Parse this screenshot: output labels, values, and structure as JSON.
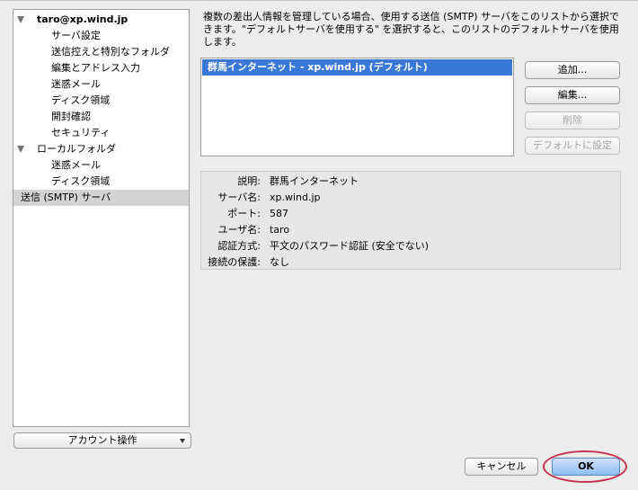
{
  "tree": {
    "account": "taro@xp.wind.jp",
    "account_children": [
      "サーバ設定",
      "送信控えと特別なフォルダ",
      "編集とアドレス入力",
      "迷惑メール",
      "ディスク領域",
      "開封確認",
      "セキュリティ"
    ],
    "local": "ローカルフォルダ",
    "local_children": [
      "迷惑メール",
      "ディスク領域"
    ],
    "smtp": "送信 (SMTP) サーバ"
  },
  "account_actions_label": "アカウント操作",
  "description": "複数の差出人情報を管理している場合、使用する送信 (SMTP) サーバをこのリストから選択できます。\"デフォルトサーバを使用する\" を選択すると、このリストのデフォルトサーバを使用します。",
  "servers": [
    "群馬インターネット - xp.wind.jp (デフォルト)"
  ],
  "buttons": {
    "add": "追加...",
    "edit": "編集...",
    "delete": "削除",
    "set_default": "デフォルトに設定",
    "cancel": "キャンセル",
    "ok": "OK"
  },
  "details": {
    "description_label": "説明:",
    "description_value": "群馬インターネット",
    "server_label": "サーバ名:",
    "server_value": "xp.wind.jp",
    "port_label": "ポート:",
    "port_value": "587",
    "user_label": "ユーザ名:",
    "user_value": "taro",
    "auth_label": "認証方式:",
    "auth_value": "平文のパスワード認証 (安全でない)",
    "security_label": "接続の保護:",
    "security_value": "なし"
  }
}
